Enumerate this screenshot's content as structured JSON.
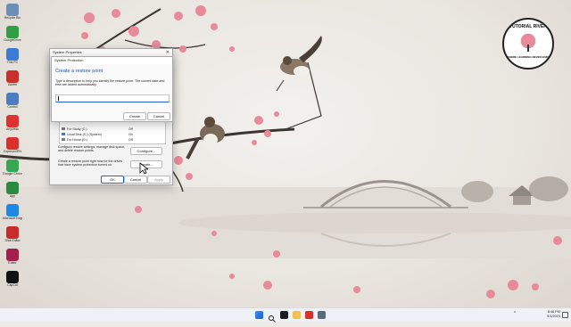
{
  "logo": {
    "text_top": "TUTORIAL RIVER",
    "text_bottom": "WHERE LEARNING NEVER ENDS"
  },
  "desktop_icons": [
    {
      "label": "Recycle Bin",
      "color": "#6c8fb8"
    },
    {
      "label": "GoogleDrive",
      "color": "#2f9e44"
    },
    {
      "label": "This PC",
      "color": "#3a7bd5"
    },
    {
      "label": "Adobe",
      "color": "#c9302c"
    },
    {
      "label": "Control",
      "color": "#4d7cbf"
    },
    {
      "label": "AnyDesk",
      "color": "#e03131"
    },
    {
      "label": "ExpressVPN",
      "color": "#d9302c"
    },
    {
      "label": "Google Chrome",
      "color": "#34a853"
    },
    {
      "label": "App",
      "color": "#2b8a3e"
    },
    {
      "label": "Microsoft Edge",
      "color": "#1e88e5"
    },
    {
      "label": "Shot Editor",
      "color": "#c92a2a"
    },
    {
      "label": "Editor",
      "color": "#a61e4d"
    },
    {
      "label": "CapCut",
      "color": "#111111"
    }
  ],
  "system_properties": {
    "title": "System Properties",
    "drives": [
      {
        "name": "For Study (C:)",
        "status": "Off"
      },
      {
        "name": "Local Disk (C:) (System)",
        "status": "On"
      },
      {
        "name": "For Home (D:)",
        "status": "Off"
      }
    ],
    "configure_text": "Configure restore settings, manage disk space, and delete restore points.",
    "configure_button": "Configure...",
    "create_text": "Create a restore point right now for the drives that have system protection turned on.",
    "create_button": "Create...",
    "ok_button": "OK",
    "cancel_button": "Cancel",
    "apply_button": "Apply"
  },
  "system_protection": {
    "title": "System Protection",
    "heading": "Create a restore point",
    "description": "Type a description to help you identify the restore point. The current date and time are added automatically.",
    "input_value": "",
    "create_button": "Create",
    "cancel_button": "Cancel"
  },
  "taskbar": {
    "time": "8:46 PM",
    "date": "5/1/2023"
  }
}
